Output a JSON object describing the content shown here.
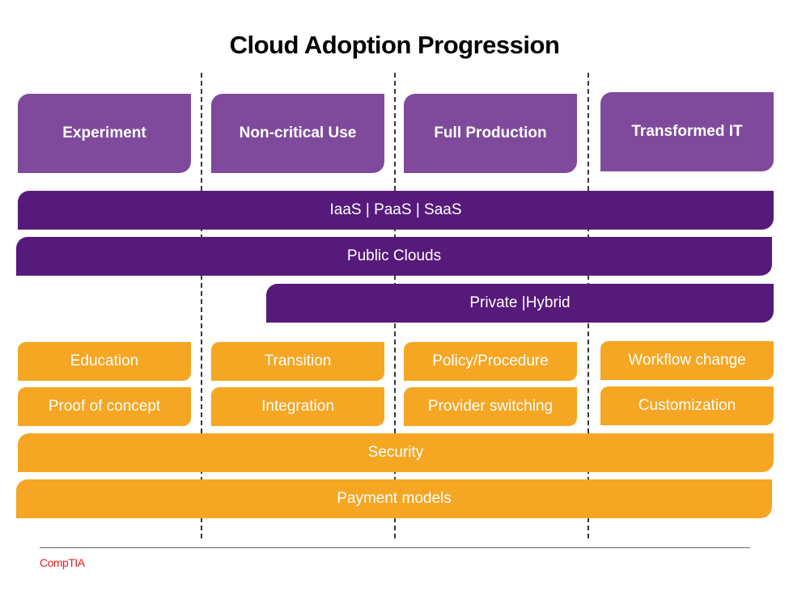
{
  "title": "Cloud Adoption Progression",
  "colors": {
    "stage_purple": "#7f4a9c",
    "bar_purple": "#561a7a",
    "orange": "#f5a623",
    "brand_red": "#e0201b",
    "divider": "#3a3a3a"
  },
  "stages": [
    {
      "label": "Experiment"
    },
    {
      "label": "Non-critical Use"
    },
    {
      "label": "Full Production"
    },
    {
      "label": "Transformed IT"
    }
  ],
  "platform_bars": [
    {
      "label": "IaaS | PaaS | SaaS",
      "spans_stages": "Experiment–Transformed IT"
    },
    {
      "label": "Public Clouds",
      "spans_stages": "Experiment–Transformed IT"
    },
    {
      "label": "Private |Hybrid",
      "spans_stages": "Non-critical Use (partial)–Transformed IT"
    }
  ],
  "activities": [
    {
      "stage": "Experiment",
      "items": [
        "Education",
        "Proof of concept"
      ]
    },
    {
      "stage": "Non-critical Use",
      "items": [
        "Transition",
        "Integration"
      ]
    },
    {
      "stage": "Full Production",
      "items": [
        "Policy/Procedure",
        "Provider switching"
      ]
    },
    {
      "stage": "Transformed IT",
      "items": [
        "Workflow change",
        "Customization"
      ]
    }
  ],
  "concern_bars": [
    {
      "label": "Security"
    },
    {
      "label": "Payment models"
    }
  ],
  "footer": {
    "brand": "CompTIA"
  }
}
